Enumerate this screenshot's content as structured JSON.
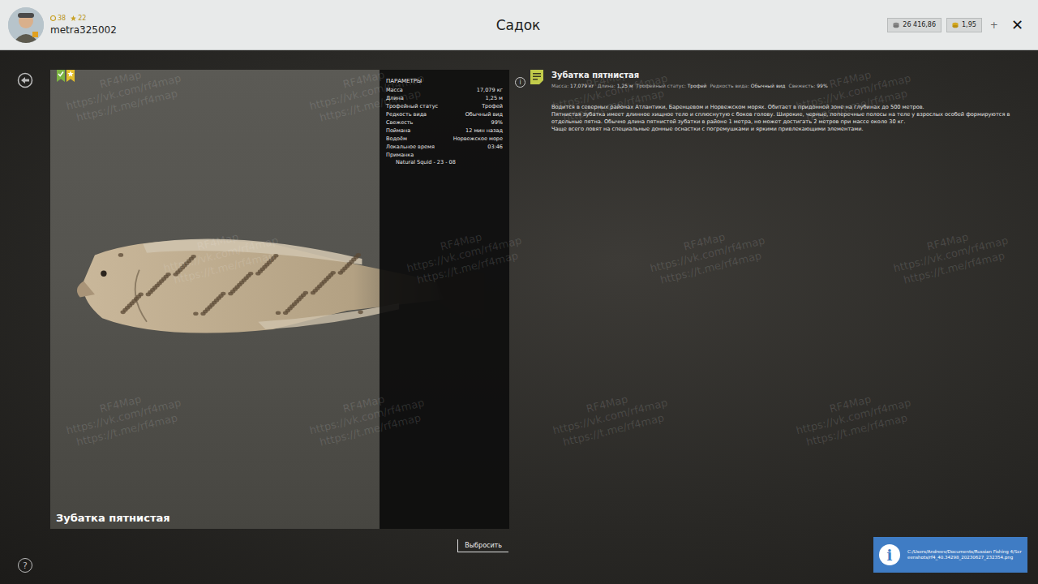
{
  "header": {
    "level": "38",
    "stars": "22",
    "username": "metra325002",
    "title": "Садок",
    "silver": "26 416,86",
    "gold": "1,95",
    "add": "+",
    "close": "✕"
  },
  "badges": [
    {
      "kind": "check",
      "color": "#7cb342"
    },
    {
      "kind": "star",
      "color": "#e2bd2a"
    }
  ],
  "fish_caption": "Зубатка пятнистая",
  "params": {
    "title": "ПАРАМЕТРЫ",
    "rows": [
      {
        "label": "Масса",
        "value": "17,079 кг"
      },
      {
        "label": "Длина",
        "value": "1,25 м"
      },
      {
        "label": "Трофейный статус",
        "value": "Трофей"
      },
      {
        "label": "Редкость вида",
        "value": "Обычный вид"
      },
      {
        "label": "Свежесть",
        "value": "99%"
      },
      {
        "label": "Поймана",
        "value": "12 мин назад"
      },
      {
        "label": "Водоём",
        "value": "Норвежское море"
      },
      {
        "label": "Локальное время",
        "value": "03:46"
      }
    ],
    "bait": {
      "label": "Приманка",
      "value": "Natural Squid - 23 - 08"
    },
    "info": "i"
  },
  "discard_button": "Выбросить",
  "info": {
    "title": "Зубатка пятнистая",
    "meta": [
      {
        "label": "Масса:",
        "value": "17,079 кг"
      },
      {
        "label": "Длина:",
        "value": "1,25 м"
      },
      {
        "label": "Трофейный статус:",
        "value": "Трофей"
      },
      {
        "label": "Редкость вида:",
        "value": "Обычный вид"
      },
      {
        "label": "Свежесть:",
        "value": "99%"
      }
    ],
    "description": [
      "Водится в северных районах Атлантики, Баренцевом и Норвежском морях. Обитает в придонной зоне на глубинах до 500 метров.",
      "Пятнистая зубатка имеет длинное хищное тело и сплюснутую с боков голову. Широкие, черные, поперечные полосы на теле у взрослых особей формируются в отдельные пятна. Обычно длина пятнистой зубатки в районе 1 метра, но может достигать 2 метров при массе около 30 кг.",
      "Чаще всего ловят на специальные донные оснастки с погремушками и яркими привлекающими элементами."
    ]
  },
  "help": "?",
  "notification": {
    "icon": "i",
    "text": "C:/Users/Andreev/Documents/Russian Fishing 4/Screenshots/rf4_40.34298_20230627_232354.png"
  },
  "watermarks": [
    {
      "lines": [
        "RF4Map",
        "https://vk.com/rf4map",
        "https://t.me/rf4map"
      ]
    },
    {
      "lines": [
        "RF4Map",
        "https://vk.com/rf4map",
        "https://t.me/rf4map"
      ]
    },
    {
      "lines": [
        "RF4Map",
        "https://vk.com/rf4map",
        "https://t.me/rf4map"
      ]
    },
    {
      "lines": [
        "RF4Map",
        "https://vk.com/rf4map",
        "https://t.me/rf4map"
      ]
    },
    {
      "lines": [
        "RF4Map",
        "https://vk.com/rf4map",
        "https://t.me/rf4map"
      ]
    },
    {
      "lines": [
        "RF4Map",
        "https://vk.com/rf4map",
        "https://t.me/rf4map"
      ]
    },
    {
      "lines": [
        "RF4Map",
        "https://vk.com/rf4map",
        "https://t.me/rf4map"
      ]
    },
    {
      "lines": [
        "RF4Map",
        "https://vk.com/rf4map",
        "https://t.me/rf4map"
      ]
    },
    {
      "lines": [
        "RF4Map",
        "https://vk.com/rf4map",
        "https://t.me/rf4map"
      ]
    },
    {
      "lines": [
        "RF4Map",
        "https://vk.com/rf4map",
        "https://t.me/rf4map"
      ]
    },
    {
      "lines": [
        "RF4Map",
        "https://vk.com/rf4map",
        "https://t.me/rf4map"
      ]
    },
    {
      "lines": [
        "RF4Map",
        "https://vk.com/rf4map",
        "https://t.me/rf4map"
      ]
    }
  ]
}
